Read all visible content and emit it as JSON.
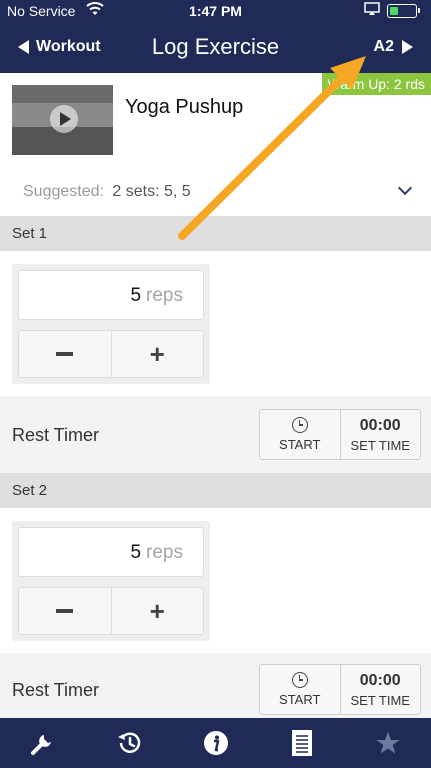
{
  "status": {
    "carrier": "No Service",
    "time": "1:47 PM",
    "battery_level": 0.35
  },
  "nav": {
    "back_label": "Workout",
    "title": "Log Exercise",
    "next_label": "A2"
  },
  "exercise": {
    "name": "Yoga Pushup",
    "badge": "Warm Up: 2 rds",
    "suggested_label": "Suggested:",
    "suggested_value": "2 sets: 5, 5"
  },
  "sets": [
    {
      "label": "Set 1",
      "reps": "5",
      "unit": "reps"
    },
    {
      "label": "Set 2",
      "reps": "5",
      "unit": "reps"
    }
  ],
  "rest": {
    "label": "Rest Timer",
    "start_label": "START",
    "time": "00:00",
    "set_time_label": "SET TIME"
  },
  "stepper": {
    "plus": "+"
  },
  "tabs": [
    "wrench-icon",
    "history-icon",
    "info-icon",
    "notes-icon",
    "star-icon"
  ],
  "colors": {
    "navy": "#1f2a57",
    "badge_green": "#8cc63f",
    "arrow_orange": "#f5a623"
  }
}
